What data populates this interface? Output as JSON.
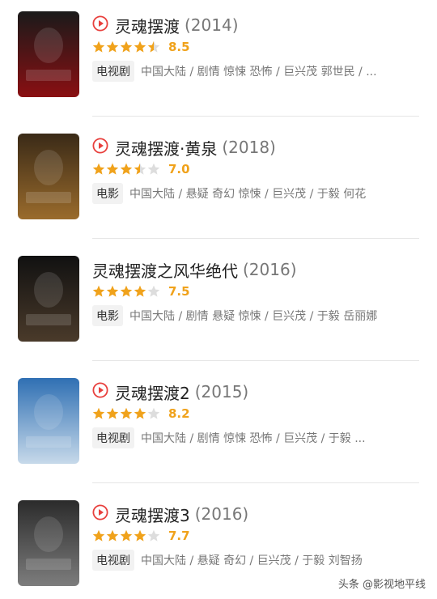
{
  "items": [
    {
      "title": "灵魂摆渡",
      "year": "(2014)",
      "show_play_icon": true,
      "rating": 4.5,
      "score": "8.5",
      "type": "电视剧",
      "meta": "中国大陆 / 剧情 惊悚 恐怖 / 巨兴茂 郭世民 / ...",
      "poster_colors": [
        "#1a1a1a",
        "#8a0f12"
      ]
    },
    {
      "title": "灵魂摆渡·黄泉",
      "year": "(2018)",
      "show_play_icon": true,
      "rating": 3.5,
      "score": "7.0",
      "type": "电影",
      "meta": "中国大陆 / 悬疑 奇幻 惊悚 / 巨兴茂 / 于毅 何花",
      "poster_colors": [
        "#3a2a17",
        "#9a6b2c"
      ]
    },
    {
      "title": "灵魂摆渡之风华绝代",
      "year": "(2016)",
      "show_play_icon": false,
      "rating": 4,
      "score": "7.5",
      "type": "电影",
      "meta": "中国大陆 / 剧情 悬疑 惊悚 / 巨兴茂 / 于毅 岳丽娜",
      "poster_colors": [
        "#111111",
        "#4a3a2a"
      ]
    },
    {
      "title": "灵魂摆渡2",
      "year": "(2015)",
      "show_play_icon": true,
      "rating": 4,
      "score": "8.2",
      "type": "电视剧",
      "meta": "中国大陆 / 剧情 惊悚 恐怖 / 巨兴茂 / 于毅 ...",
      "poster_colors": [
        "#2f6fb3",
        "#c7d9ea"
      ]
    },
    {
      "title": "灵魂摆渡3",
      "year": "(2016)",
      "show_play_icon": true,
      "rating": 4,
      "score": "7.7",
      "type": "电视剧",
      "meta": "中国大陆 / 悬疑 奇幻 / 巨兴茂 / 于毅 刘智扬",
      "poster_colors": [
        "#2b2b2b",
        "#7d7d7d"
      ]
    }
  ],
  "watermark": "头条 @影视地平线",
  "colors": {
    "star_on": "#f0a21b",
    "star_off": "#dddddd",
    "play_icon": "#e8403d"
  }
}
